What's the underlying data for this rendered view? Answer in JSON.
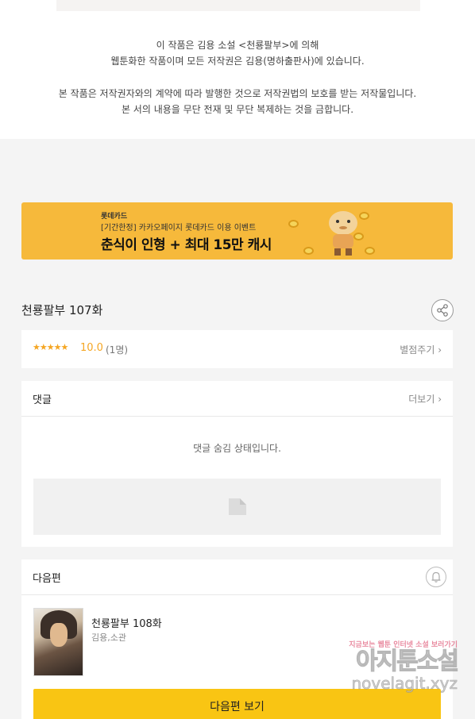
{
  "notice": {
    "line1": "이 작품은 김용 소설 <천룡팔부>에 의해",
    "line2": "웹툰화한 작품이며 모든 저작권은 김용(명하출판사)에 있습니다.",
    "line3": "본 작품은 저작권자와의 계약에 따라 발행한 것으로 저작권법의 보호를 받는 저작물입니다.",
    "line4": "본 서의 내용을 무단 전재 및 무단 복제하는 것을 금합니다."
  },
  "banner": {
    "brand": "롯데카드",
    "subtitle": "[기간한정] 카카오페이지 롯데카드 이용 이벤트",
    "title": "춘식이 인형 + 최대 15만 캐시",
    "color": "#f6b93b"
  },
  "episode": {
    "title": "천룡팔부 107화",
    "share_icon": "share-icon"
  },
  "rating": {
    "stars": "★★★★★",
    "score": "10.0",
    "count": "(1명)",
    "rate_link": "별점주기 ›"
  },
  "comments": {
    "title": "댓글",
    "more": "더보기 ›",
    "hidden_message": "댓글 숨김 상태입니다."
  },
  "next": {
    "title": "다음편",
    "episode_title": "천룡팔부 108화",
    "authors": "김용,소관",
    "button": "다음편 보기",
    "button_color": "#f9c513"
  },
  "watermark": {
    "tagline": "지금보는 웹툰 인터넷 소설 보러가기",
    "site_name": "아지툰소설",
    "url": "novelagit.xyz"
  }
}
